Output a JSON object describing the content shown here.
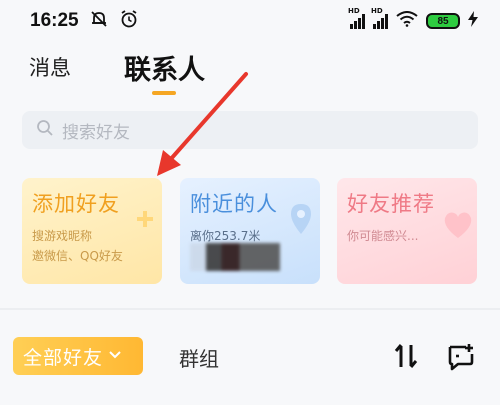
{
  "status_bar": {
    "time": "16:25",
    "signal_1_label": "HD",
    "signal_2_label": "HD",
    "battery_level": "85",
    "icons": [
      "notification-muted-icon",
      "alarm-icon",
      "signal-icon",
      "wifi-icon",
      "battery-icon",
      "charging-icon"
    ]
  },
  "tabs": {
    "messages": "消息",
    "contacts": "联系人",
    "active": "contacts",
    "accent_color": "#f5a623"
  },
  "search": {
    "placeholder": "搜索好友"
  },
  "cards": {
    "add_friend": {
      "title": "添加好友",
      "line1": "搜游戏昵称",
      "line2": "邀微信、QQ好友"
    },
    "nearby": {
      "title": "附近的人",
      "distance": "离你253.7米"
    },
    "recommend": {
      "title": "好友推荐",
      "subtitle": "你可能感兴..."
    }
  },
  "filters": {
    "all_friends": "全部好友",
    "groups": "群组"
  },
  "annotation": {
    "arrow_color": "#e8372c"
  }
}
